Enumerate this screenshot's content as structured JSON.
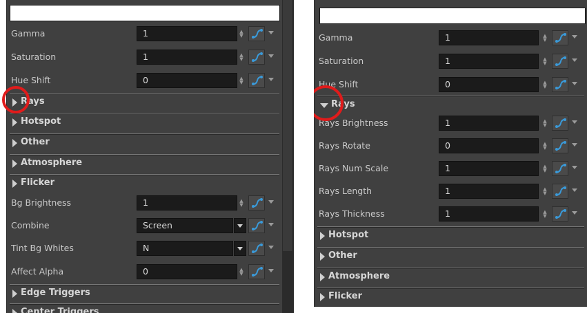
{
  "left_panel": {
    "top_field_value": "",
    "rows_top": [
      {
        "label": "Gamma",
        "value": "1"
      },
      {
        "label": "Saturation",
        "value": "1"
      },
      {
        "label": "Hue Shift",
        "value": "0"
      }
    ],
    "sections_a": [
      {
        "title": "Rays",
        "state": "collapsed"
      },
      {
        "title": "Hotspot",
        "state": "collapsed"
      },
      {
        "title": "Other",
        "state": "collapsed"
      },
      {
        "title": "Atmosphere",
        "state": "collapsed"
      },
      {
        "title": "Flicker",
        "state": "collapsed"
      }
    ],
    "rows_bottom": [
      {
        "label": "Bg Brightness",
        "value": "1",
        "kind": "number"
      },
      {
        "label": "Combine",
        "value": "Screen",
        "kind": "dropdown"
      },
      {
        "label": "Tint Bg Whites",
        "value": "N",
        "kind": "dropdown"
      },
      {
        "label": "Affect Alpha",
        "value": "0",
        "kind": "number"
      }
    ],
    "sections_b": [
      {
        "title": "Edge Triggers",
        "state": "collapsed"
      },
      {
        "title": "Center Triggers",
        "state": "collapsed"
      }
    ]
  },
  "right_panel": {
    "top_field_value": "",
    "rows_top": [
      {
        "label": "Gamma",
        "value": "1"
      },
      {
        "label": "Saturation",
        "value": "1"
      },
      {
        "label": "Hue Shift",
        "value": "0"
      }
    ],
    "rays_section": {
      "title": "Rays",
      "state": "expanded"
    },
    "rays_rows": [
      {
        "label": "Rays Brightness",
        "value": "1"
      },
      {
        "label": "Rays Rotate",
        "value": "0"
      },
      {
        "label": "Rays Num Scale",
        "value": "1"
      },
      {
        "label": "Rays Length",
        "value": "1"
      },
      {
        "label": "Rays Thickness",
        "value": "1"
      }
    ],
    "sections_after": [
      {
        "title": "Hotspot",
        "state": "collapsed"
      },
      {
        "title": "Other",
        "state": "collapsed"
      },
      {
        "title": "Atmosphere",
        "state": "collapsed"
      },
      {
        "title": "Flicker",
        "state": "collapsed"
      }
    ]
  },
  "icons": {
    "spinner": "spinner-arrows-icon",
    "curve": "function-curve-icon",
    "menu": "chevron-down-icon",
    "section_collapsed": "triangle-right-icon",
    "section_expanded": "triangle-down-icon"
  },
  "colors": {
    "panel_bg": "#404040",
    "field_bg": "#1b1b1b",
    "highlight_ring": "#e01b1b",
    "curve_icon": "#3a9ad9"
  }
}
